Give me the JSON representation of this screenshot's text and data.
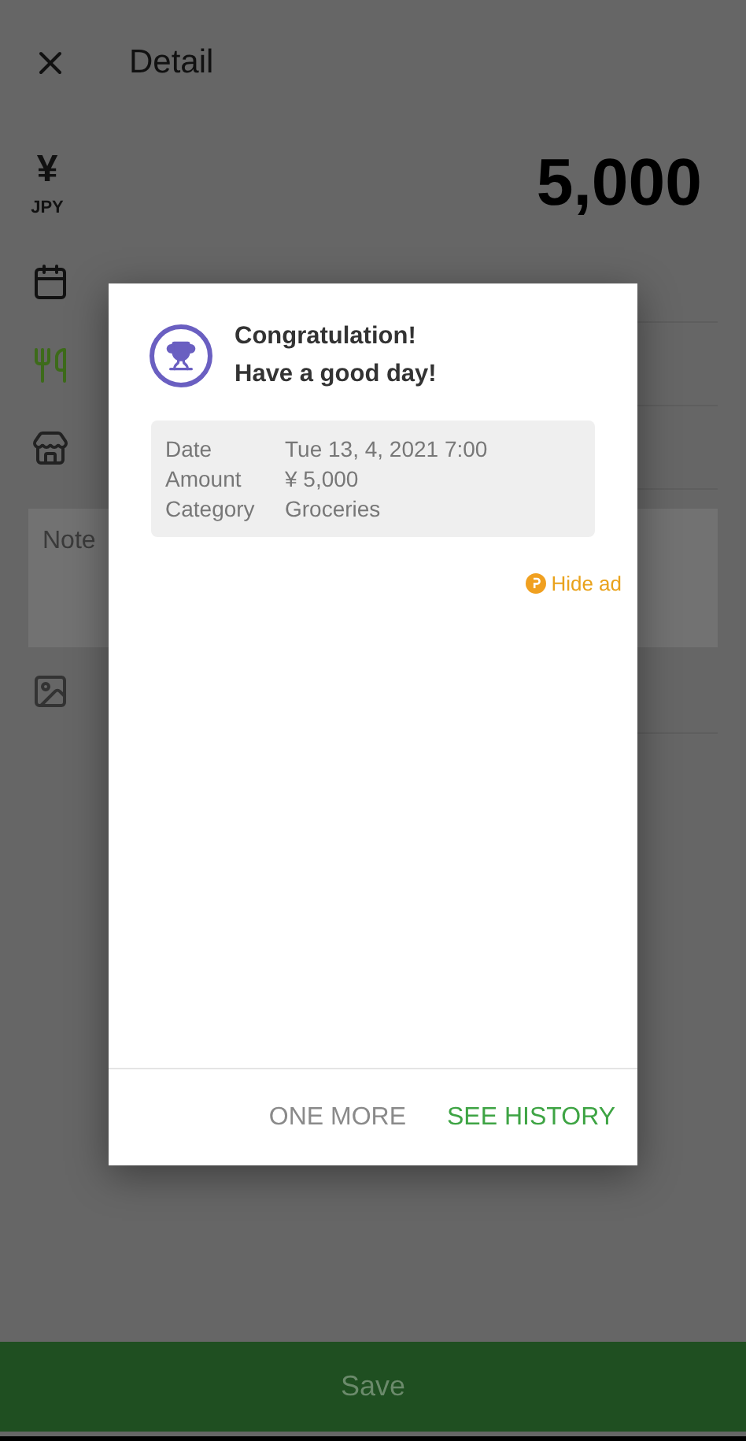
{
  "header": {
    "title": "Detail"
  },
  "amount": {
    "currency_symbol": "¥",
    "currency_code": "JPY",
    "value": "5,000"
  },
  "fields": [
    {
      "kind": "date"
    },
    {
      "kind": "category"
    },
    {
      "kind": "shop"
    }
  ],
  "notes": {
    "placeholder": "Note"
  },
  "dialog": {
    "title_lines": [
      "Congratulation!",
      "Have a good day!"
    ],
    "details": [
      {
        "label": "Date",
        "value": "Tue 13, 4, 2021 7:00"
      },
      {
        "label": "Amount",
        "value": "¥ 5,000"
      },
      {
        "label": "Category",
        "value": "Groceries"
      }
    ],
    "hide_ad": "Hide ad",
    "buttons": [
      {
        "label": "ONE MORE",
        "kind": "secondary"
      },
      {
        "label": "SEE HISTORY",
        "kind": "primary"
      }
    ]
  },
  "save_button": {
    "label": "Save",
    "disabled": true
  }
}
